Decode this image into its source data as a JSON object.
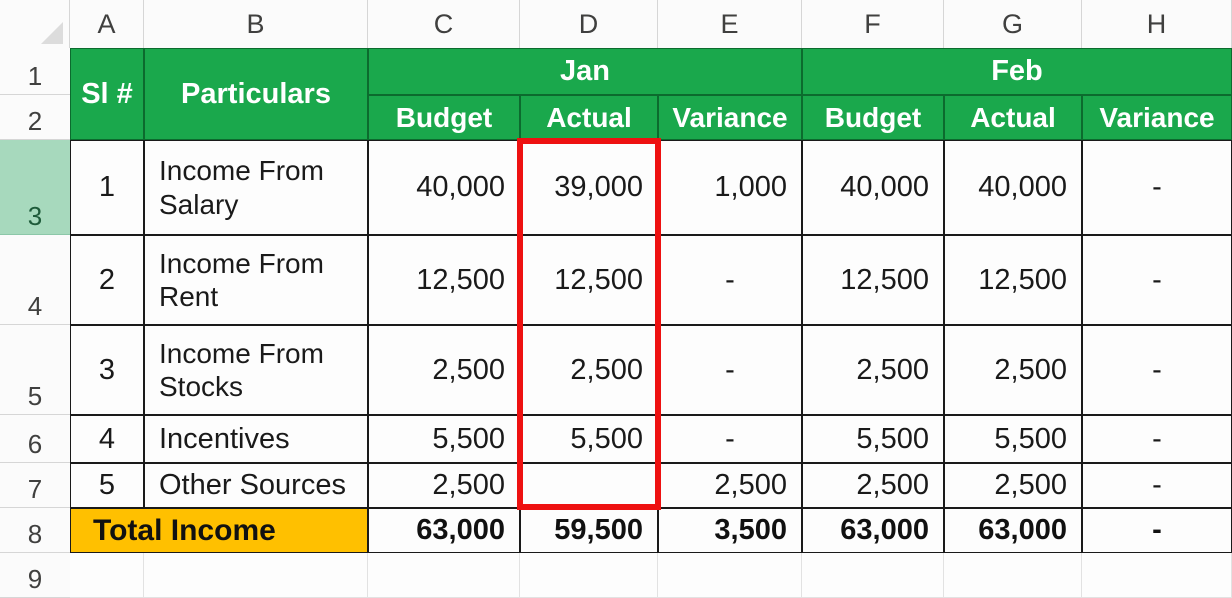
{
  "spreadsheet": {
    "column_headers": [
      "A",
      "B",
      "C",
      "D",
      "E",
      "F",
      "G",
      "H"
    ],
    "row_headers": [
      "1",
      "2",
      "3",
      "4",
      "5",
      "6",
      "7",
      "8",
      "9"
    ],
    "selected_row": "3",
    "select_all_icon": "select-all-triangle-icon",
    "colors": {
      "header_green": "#1aa84c",
      "total_orange": "#ffc000",
      "selection_red": "#ee1111",
      "row_selected_green": "#a7d9bd"
    }
  },
  "table": {
    "corner_headers": {
      "sl": "Sl #",
      "particulars": "Particulars"
    },
    "month_groups": [
      {
        "label": "Jan",
        "columns": [
          "C",
          "D",
          "E"
        ]
      },
      {
        "label": "Feb",
        "columns": [
          "F",
          "G",
          "H"
        ]
      }
    ],
    "sub_headers": {
      "budget": "Budget",
      "actual": "Actual",
      "variance": "Variance"
    },
    "rows": [
      {
        "sl": "1",
        "particulars": "Income From Salary",
        "jan_budget": "40,000",
        "jan_actual": "39,000",
        "jan_variance": "1,000",
        "feb_budget": "40,000",
        "feb_actual": "40,000",
        "feb_variance": "-"
      },
      {
        "sl": "2",
        "particulars": "Income From Rent",
        "jan_budget": "12,500",
        "jan_actual": "12,500",
        "jan_variance": "-",
        "feb_budget": "12,500",
        "feb_actual": "12,500",
        "feb_variance": "-"
      },
      {
        "sl": "3",
        "particulars": "Income From Stocks",
        "jan_budget": "2,500",
        "jan_actual": "2,500",
        "jan_variance": "-",
        "feb_budget": "2,500",
        "feb_actual": "2,500",
        "feb_variance": "-"
      },
      {
        "sl": "4",
        "particulars": "Incentives",
        "jan_budget": "5,500",
        "jan_actual": "5,500",
        "jan_variance": "-",
        "feb_budget": "5,500",
        "feb_actual": "5,500",
        "feb_variance": "-"
      },
      {
        "sl": "5",
        "particulars": "Other Sources",
        "jan_budget": "2,500",
        "jan_actual": "",
        "jan_variance": "2,500",
        "feb_budget": "2,500",
        "feb_actual": "2,500",
        "feb_variance": "-"
      }
    ],
    "total": {
      "label": "Total Income",
      "jan_budget": "63,000",
      "jan_actual": "59,500",
      "jan_variance": "3,500",
      "feb_budget": "63,000",
      "feb_actual": "63,000",
      "feb_variance": "-"
    }
  },
  "chart_data": {
    "type": "table",
    "title": "Total Income",
    "categories": [
      "Income From Salary",
      "Income From Rent",
      "Income From Stocks",
      "Incentives",
      "Other Sources"
    ],
    "series": [
      {
        "name": "Jan Budget",
        "values": [
          40000,
          12500,
          2500,
          5500,
          2500
        ]
      },
      {
        "name": "Jan Actual",
        "values": [
          39000,
          12500,
          2500,
          5500,
          null
        ]
      },
      {
        "name": "Jan Variance",
        "values": [
          1000,
          0,
          0,
          0,
          2500
        ]
      },
      {
        "name": "Feb Budget",
        "values": [
          40000,
          12500,
          2500,
          5500,
          2500
        ]
      },
      {
        "name": "Feb Actual",
        "values": [
          40000,
          12500,
          2500,
          5500,
          2500
        ]
      },
      {
        "name": "Feb Variance",
        "values": [
          0,
          0,
          0,
          0,
          0
        ]
      }
    ],
    "totals": {
      "Jan Budget": 63000,
      "Jan Actual": 59500,
      "Jan Variance": 3500,
      "Feb Budget": 63000,
      "Feb Actual": 63000,
      "Feb Variance": 0
    }
  }
}
